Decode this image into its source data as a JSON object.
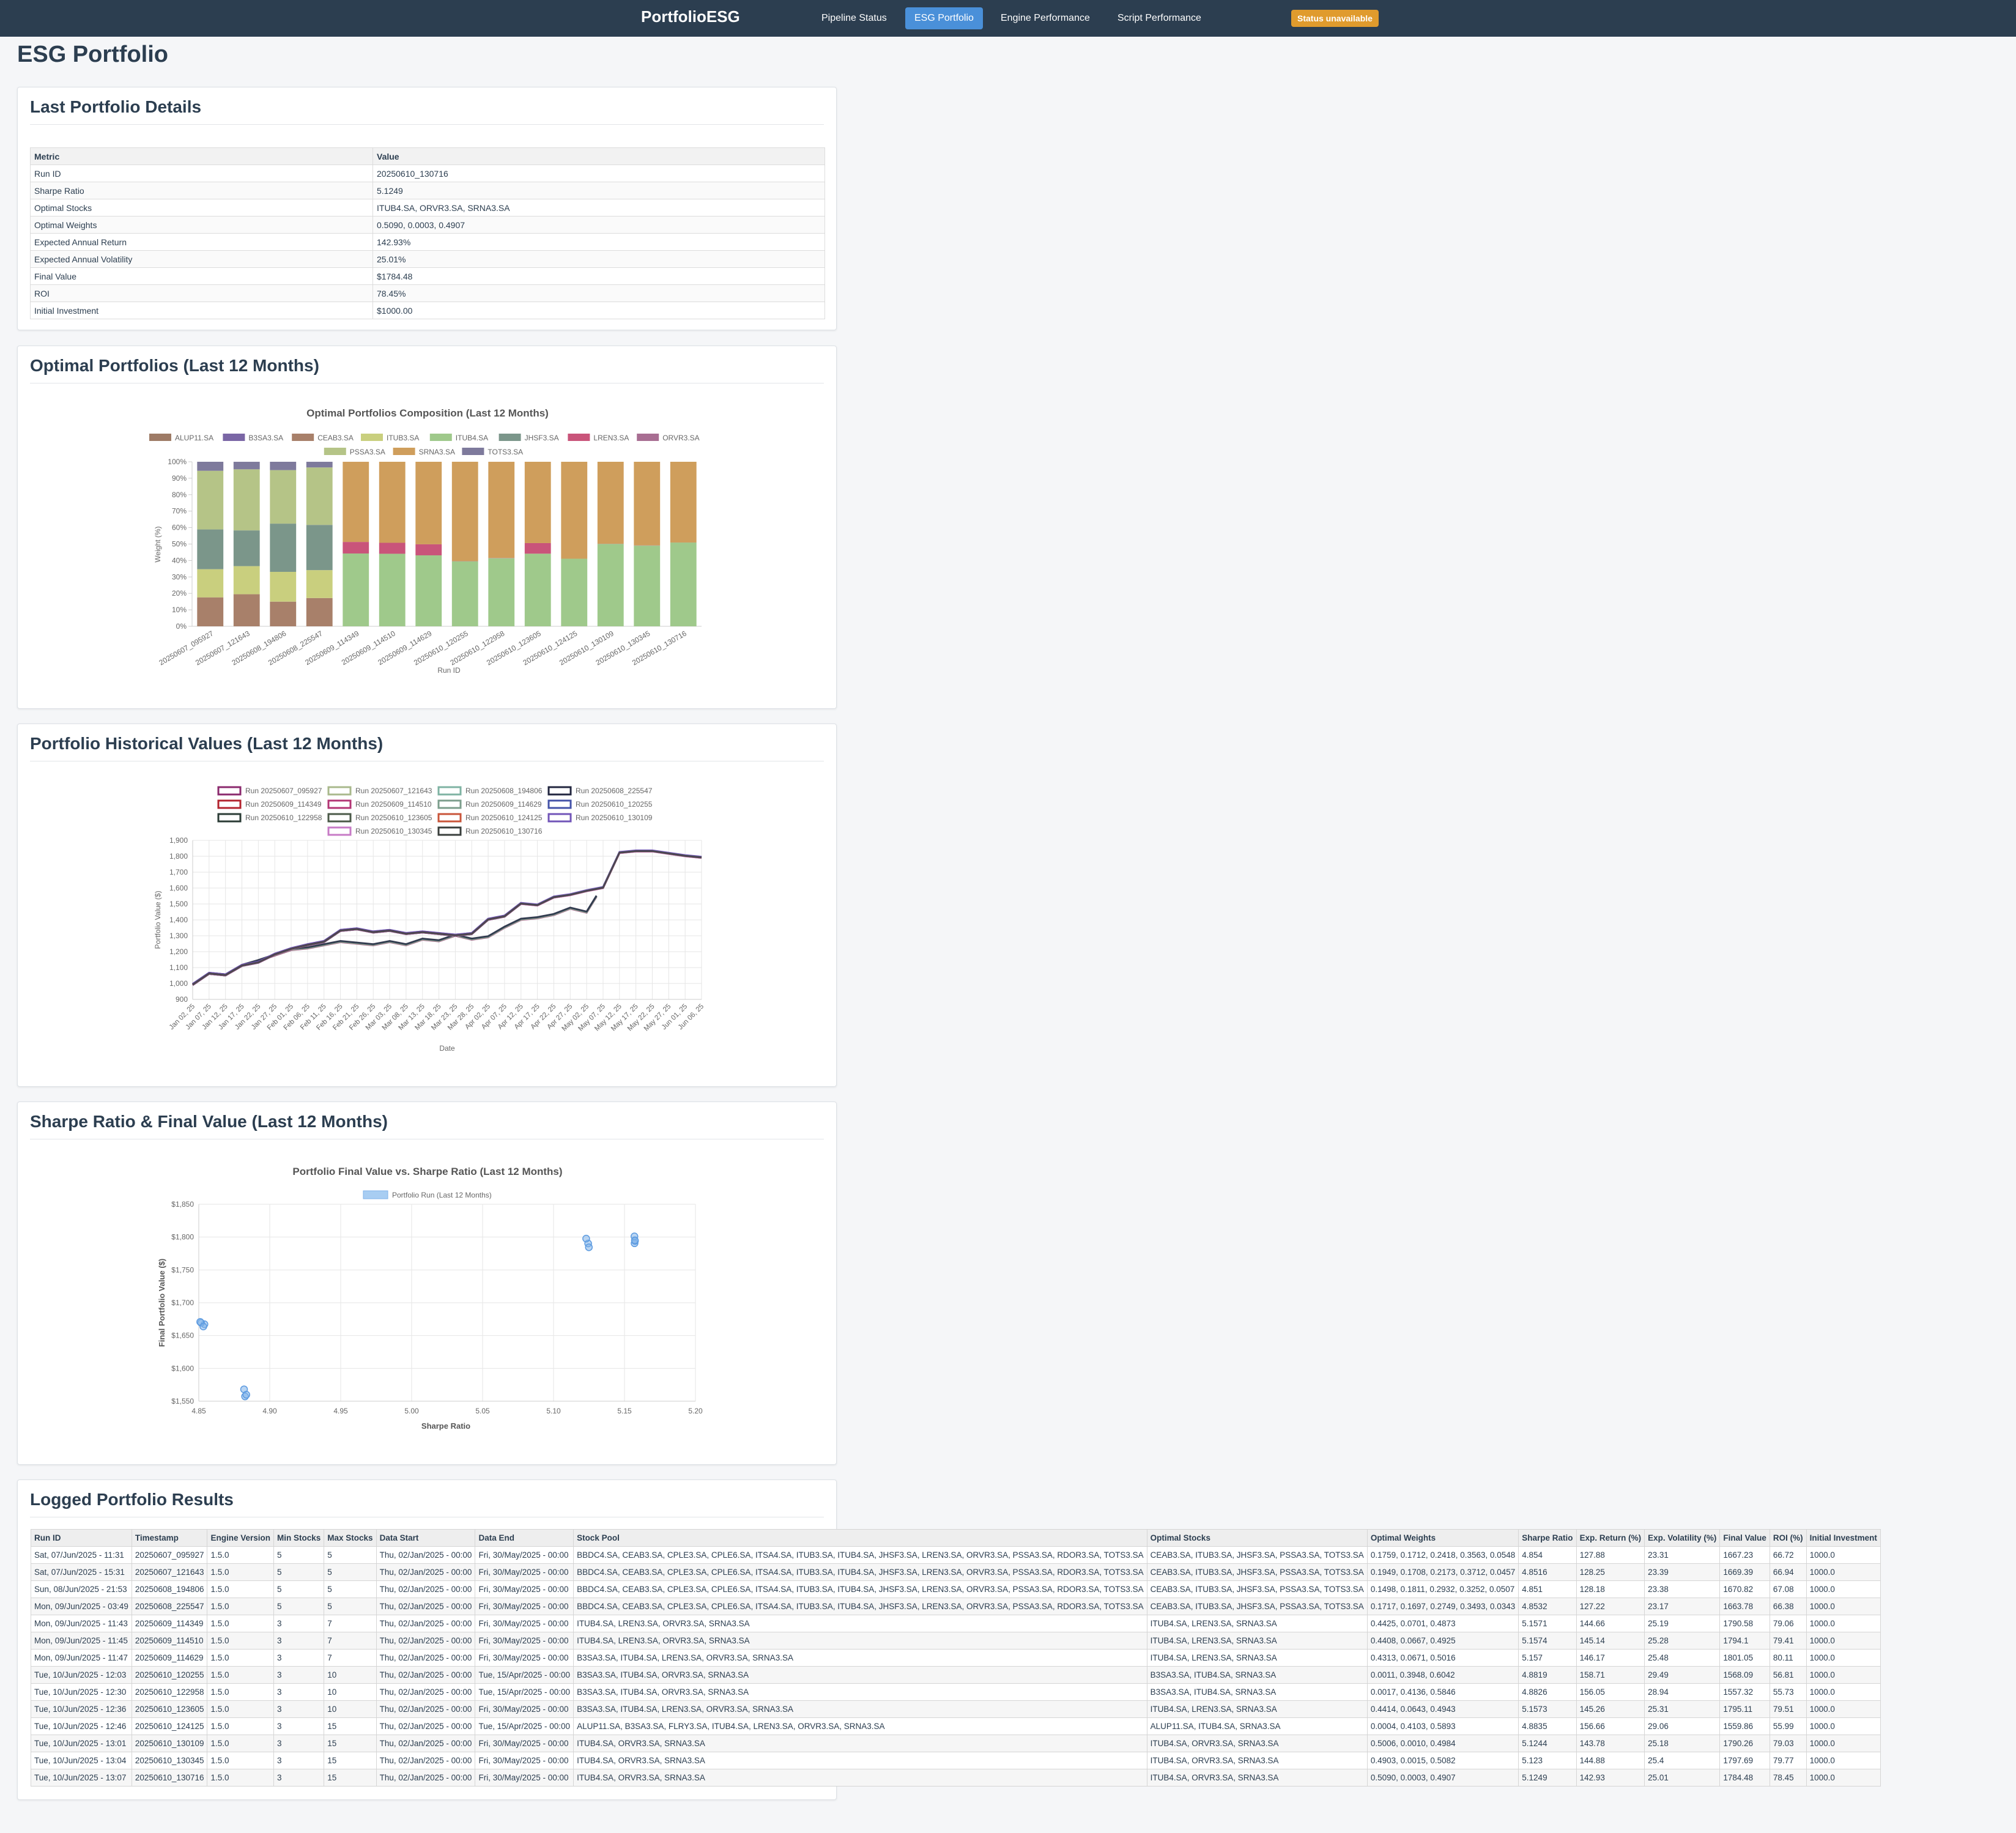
{
  "navbar": {
    "brand": "PortfolioESG",
    "links": [
      "Pipeline Status",
      "ESG Portfolio",
      "Engine Performance",
      "Script Performance"
    ],
    "status": "Status unavailable"
  },
  "page_title": "ESG Portfolio",
  "details": {
    "title": "Last Portfolio Details",
    "headers": [
      "Metric",
      "Value"
    ],
    "rows": [
      [
        "Run ID",
        "20250610_130716"
      ],
      [
        "Sharpe Ratio",
        "5.1249"
      ],
      [
        "Optimal Stocks",
        "ITUB4.SA, ORVR3.SA, SRNA3.SA"
      ],
      [
        "Optimal Weights",
        "0.5090, 0.0003, 0.4907"
      ],
      [
        "Expected Annual Return",
        "142.93%"
      ],
      [
        "Expected Annual Volatility",
        "25.01%"
      ],
      [
        "Final Value",
        "$1784.48"
      ],
      [
        "ROI",
        "78.45%"
      ],
      [
        "Initial Investment",
        "$1000.00"
      ]
    ]
  },
  "composition_section": {
    "title": "Optimal Portfolios (Last 12 Months)"
  },
  "history_section": {
    "title": "Portfolio Historical Values (Last 12 Months)"
  },
  "sharpe_section": {
    "title": "Sharpe Ratio & Final Value (Last 12 Months)"
  },
  "logged_section": {
    "title": "Logged Portfolio Results"
  },
  "chart_data": [
    {
      "type": "bar",
      "stacked": true,
      "title": "Optimal Portfolios Composition (Last 12 Months)",
      "xlabel": "Run ID",
      "ylabel": "Weight (%)",
      "ylim": [
        0,
        100
      ],
      "y_ticks": [
        "0%",
        "10%",
        "20%",
        "30%",
        "40%",
        "50%",
        "60%",
        "70%",
        "80%",
        "90%",
        "100%"
      ],
      "categories": [
        "20250607_095927",
        "20250607_121643",
        "20250608_194806",
        "20250608_225547",
        "20250609_114349",
        "20250609_114510",
        "20250609_114629",
        "20250610_120255",
        "20250610_122958",
        "20250610_123605",
        "20250610_124125",
        "20250610_130109",
        "20250610_130345",
        "20250610_130716"
      ],
      "legend_position": "top",
      "series": [
        {
          "name": "ALUP11.SA",
          "color": "#9e7b66",
          "values": [
            0,
            0,
            0,
            0,
            0,
            0,
            0,
            0,
            0,
            0,
            0.04,
            0,
            0,
            0
          ]
        },
        {
          "name": "B3SA3.SA",
          "color": "#7a66a5",
          "values": [
            0,
            0,
            0,
            0,
            0,
            0,
            0,
            0,
            0,
            0,
            0,
            0,
            0,
            0
          ]
        },
        {
          "name": "CEAB3.SA",
          "color": "#a8806a",
          "values": [
            17.59,
            19.49,
            14.98,
            17.17,
            0,
            0,
            0,
            0,
            0,
            0,
            0,
            0,
            0,
            0
          ]
        },
        {
          "name": "ITUB3.SA",
          "color": "#c9cf7e",
          "values": [
            17.12,
            17.08,
            18.11,
            16.97,
            0,
            0,
            0,
            0,
            0,
            0,
            0,
            0,
            0,
            0
          ]
        },
        {
          "name": "ITUB4.SA",
          "color": "#9fc98b",
          "values": [
            0,
            0,
            0,
            0,
            44.25,
            44.08,
            43.13,
            39.48,
            41.36,
            44.14,
            41.03,
            50.06,
            49.03,
            50.9
          ]
        },
        {
          "name": "JHSF3.SA",
          "color": "#7b968a",
          "values": [
            24.18,
            21.73,
            29.32,
            27.49,
            0,
            0,
            0,
            0,
            0,
            0,
            0,
            0,
            0,
            0
          ]
        },
        {
          "name": "LREN3.SA",
          "color": "#c9547a",
          "values": [
            0,
            0,
            0,
            0,
            7.01,
            6.67,
            6.71,
            0,
            0,
            6.43,
            0,
            0,
            0,
            0
          ]
        },
        {
          "name": "ORVR3.SA",
          "color": "#a86e92",
          "values": [
            0,
            0,
            0,
            0,
            0,
            0,
            0,
            0.11,
            0.17,
            0,
            0,
            0.1,
            0.15,
            0.03
          ]
        },
        {
          "name": "PSSA3.SA",
          "color": "#b5c487",
          "values": [
            35.63,
            37.12,
            32.52,
            34.93,
            0,
            0,
            0,
            0,
            0,
            0,
            0,
            0,
            0,
            0
          ]
        },
        {
          "name": "SRNA3.SA",
          "color": "#cf9e5c",
          "values": [
            0,
            0,
            0,
            0,
            48.73,
            49.25,
            50.16,
            60.42,
            58.46,
            49.43,
            58.93,
            49.84,
            50.82,
            49.07
          ]
        },
        {
          "name": "TOTS3.SA",
          "color": "#7e7a9c",
          "values": [
            5.48,
            4.57,
            5.07,
            3.43,
            0,
            0,
            0,
            0,
            0,
            0,
            0,
            0,
            0,
            0
          ]
        }
      ]
    },
    {
      "type": "line",
      "xlabel": "Date",
      "ylabel": "Portfolio Value ($)",
      "ylim": [
        900,
        1900
      ],
      "y_ticks": [
        "900",
        "1,000",
        "1,100",
        "1,200",
        "1,300",
        "1,400",
        "1,500",
        "1,600",
        "1,700",
        "1,800",
        "1,900"
      ],
      "x_ticks": [
        "Jan 02, 25",
        "Jan 07, 25",
        "Jan 12, 25",
        "Jan 17, 25",
        "Jan 22, 25",
        "Jan 27, 25",
        "Feb 01, 25",
        "Feb 06, 25",
        "Feb 11, 25",
        "Feb 16, 25",
        "Feb 21, 25",
        "Feb 26, 25",
        "Mar 03, 25",
        "Mar 08, 25",
        "Mar 13, 25",
        "Mar 18, 25",
        "Mar 23, 25",
        "Mar 28, 25",
        "Apr 02, 25",
        "Apr 07, 25",
        "Apr 12, 25",
        "Apr 17, 25",
        "Apr 22, 25",
        "Apr 27, 25",
        "May 02, 25",
        "May 07, 25",
        "May 12, 25",
        "May 17, 25",
        "May 22, 25",
        "May 27, 25",
        "Jun 01, 25",
        "Jun 06, 25"
      ],
      "legend_position": "top",
      "series": [
        {
          "name": "Run 20250607_095927",
          "color": "#8b2a6e",
          "group": "A",
          "final": 1667
        },
        {
          "name": "Run 20250607_121643",
          "color": "#a9b98c",
          "group": "A",
          "final": 1669
        },
        {
          "name": "Run 20250608_194806",
          "color": "#7fb3a3",
          "group": "A",
          "final": 1671
        },
        {
          "name": "Run 20250608_225547",
          "color": "#22263f",
          "group": "A",
          "final": 1664
        },
        {
          "name": "Run 20250609_114349",
          "color": "#b3242f",
          "group": "B",
          "final": 1791
        },
        {
          "name": "Run 20250609_114510",
          "color": "#b33675",
          "group": "B",
          "final": 1794
        },
        {
          "name": "Run 20250609_114629",
          "color": "#7c9e8c",
          "group": "B",
          "final": 1801
        },
        {
          "name": "Run 20250610_120255",
          "color": "#4453a8",
          "group": "C",
          "final": 1568
        },
        {
          "name": "Run 20250610_122958",
          "color": "#2b3c36",
          "group": "C",
          "final": 1557
        },
        {
          "name": "Run 20250610_123605",
          "color": "#4b5a48",
          "group": "B",
          "final": 1795
        },
        {
          "name": "Run 20250610_124125",
          "color": "#c9553a",
          "group": "D",
          "final": 1560
        },
        {
          "name": "Run 20250610_130109",
          "color": "#7255b8",
          "group": "B",
          "final": 1790
        },
        {
          "name": "Run 20250610_130345",
          "color": "#c77bc6",
          "group": "B",
          "final": 1798
        },
        {
          "name": "Run 20250610_130716",
          "color": "#3a3f3c",
          "group": "B",
          "final": 1784
        }
      ],
      "group_paths": {
        "A": {
          "x": [
            0,
            5,
            10,
            15,
            20,
            25,
            30,
            35,
            40,
            45,
            50,
            55,
            60,
            65,
            70,
            75,
            80,
            85,
            90,
            95,
            100,
            105,
            110,
            115,
            120,
            123
          ],
          "y": [
            990,
            1060,
            1050,
            1110,
            1140,
            1175,
            1210,
            1220,
            1240,
            1260,
            1250,
            1240,
            1260,
            1240,
            1275,
            1265,
            1300,
            1275,
            1290,
            1350,
            1400,
            1410,
            1430,
            1470,
            1445,
            1545
          ]
        },
        "B": {
          "x": [
            0,
            5,
            10,
            15,
            20,
            25,
            30,
            35,
            40,
            45,
            50,
            55,
            60,
            65,
            70,
            75,
            80,
            85,
            90,
            95,
            100,
            105,
            110,
            115,
            120,
            125,
            130,
            135,
            140,
            145,
            150,
            155
          ],
          "y": [
            990,
            1060,
            1050,
            1110,
            1130,
            1180,
            1215,
            1240,
            1260,
            1330,
            1340,
            1320,
            1330,
            1310,
            1320,
            1310,
            1300,
            1310,
            1400,
            1420,
            1500,
            1490,
            1540,
            1555,
            1580,
            1600,
            1820,
            1830,
            1830,
            1815,
            1800,
            1790
          ]
        }
      }
    },
    {
      "type": "scatter",
      "title": "Portfolio Final Value vs. Sharpe Ratio (Last 12 Months)",
      "xlabel": "Sharpe Ratio",
      "ylabel": "Final Portfolio Value ($)",
      "xlim": [
        4.85,
        5.2
      ],
      "ylim": [
        1550,
        1850
      ],
      "x_ticks": [
        "4.85",
        "4.90",
        "4.95",
        "5.00",
        "5.05",
        "5.10",
        "5.15",
        "5.20"
      ],
      "y_ticks": [
        "$1,550",
        "$1,600",
        "$1,650",
        "$1,700",
        "$1,750",
        "$1,800",
        "$1,850"
      ],
      "legend_position": "top",
      "series": [
        {
          "name": "Portfolio Run (Last 12 Months)",
          "color": "#7fb2ea",
          "points": [
            [
              4.854,
              1667.23
            ],
            [
              4.8516,
              1669.39
            ],
            [
              4.851,
              1670.82
            ],
            [
              4.8532,
              1663.78
            ],
            [
              5.1571,
              1790.58
            ],
            [
              5.1574,
              1794.1
            ],
            [
              5.157,
              1801.05
            ],
            [
              4.8819,
              1568.09
            ],
            [
              4.8826,
              1557.32
            ],
            [
              5.1573,
              1795.11
            ],
            [
              4.8835,
              1559.86
            ],
            [
              5.1244,
              1790.26
            ],
            [
              5.123,
              1797.69
            ],
            [
              5.1249,
              1784.48
            ]
          ]
        }
      ]
    }
  ],
  "logged": {
    "headers": [
      "Run ID",
      "Timestamp",
      "Engine Version",
      "Min Stocks",
      "Max Stocks",
      "Data Start",
      "Data End",
      "Stock Pool",
      "Optimal Stocks",
      "Optimal Weights",
      "Sharpe Ratio",
      "Exp. Return (%)",
      "Exp. Volatility (%)",
      "Final Value",
      "ROI (%)",
      "Initial Investment"
    ],
    "rows": [
      [
        "Sat, 07/Jun/2025 - 11:31",
        "20250607_095927",
        "1.5.0",
        "5",
        "5",
        "Thu, 02/Jan/2025 - 00:00",
        "Fri, 30/May/2025 - 00:00",
        "BBDC4.SA, CEAB3.SA, CPLE3.SA, CPLE6.SA, ITSA4.SA, ITUB3.SA, ITUB4.SA, JHSF3.SA, LREN3.SA, ORVR3.SA, PSSA3.SA, RDOR3.SA, TOTS3.SA",
        "CEAB3.SA, ITUB3.SA, JHSF3.SA, PSSA3.SA, TOTS3.SA",
        "0.1759, 0.1712, 0.2418, 0.3563, 0.0548",
        "4.854",
        "127.88",
        "23.31",
        "1667.23",
        "66.72",
        "1000.0"
      ],
      [
        "Sat, 07/Jun/2025 - 15:31",
        "20250607_121643",
        "1.5.0",
        "5",
        "5",
        "Thu, 02/Jan/2025 - 00:00",
        "Fri, 30/May/2025 - 00:00",
        "BBDC4.SA, CEAB3.SA, CPLE3.SA, CPLE6.SA, ITSA4.SA, ITUB3.SA, ITUB4.SA, JHSF3.SA, LREN3.SA, ORVR3.SA, PSSA3.SA, RDOR3.SA, TOTS3.SA",
        "CEAB3.SA, ITUB3.SA, JHSF3.SA, PSSA3.SA, TOTS3.SA",
        "0.1949, 0.1708, 0.2173, 0.3712, 0.0457",
        "4.8516",
        "128.25",
        "23.39",
        "1669.39",
        "66.94",
        "1000.0"
      ],
      [
        "Sun, 08/Jun/2025 - 21:53",
        "20250608_194806",
        "1.5.0",
        "5",
        "5",
        "Thu, 02/Jan/2025 - 00:00",
        "Fri, 30/May/2025 - 00:00",
        "BBDC4.SA, CEAB3.SA, CPLE3.SA, CPLE6.SA, ITSA4.SA, ITUB3.SA, ITUB4.SA, JHSF3.SA, LREN3.SA, ORVR3.SA, PSSA3.SA, RDOR3.SA, TOTS3.SA",
        "CEAB3.SA, ITUB3.SA, JHSF3.SA, PSSA3.SA, TOTS3.SA",
        "0.1498, 0.1811, 0.2932, 0.3252, 0.0507",
        "4.851",
        "128.18",
        "23.38",
        "1670.82",
        "67.08",
        "1000.0"
      ],
      [
        "Mon, 09/Jun/2025 - 03:49",
        "20250608_225547",
        "1.5.0",
        "5",
        "5",
        "Thu, 02/Jan/2025 - 00:00",
        "Fri, 30/May/2025 - 00:00",
        "BBDC4.SA, CEAB3.SA, CPLE3.SA, CPLE6.SA, ITSA4.SA, ITUB3.SA, ITUB4.SA, JHSF3.SA, LREN3.SA, ORVR3.SA, PSSA3.SA, RDOR3.SA, TOTS3.SA",
        "CEAB3.SA, ITUB3.SA, JHSF3.SA, PSSA3.SA, TOTS3.SA",
        "0.1717, 0.1697, 0.2749, 0.3493, 0.0343",
        "4.8532",
        "127.22",
        "23.17",
        "1663.78",
        "66.38",
        "1000.0"
      ],
      [
        "Mon, 09/Jun/2025 - 11:43",
        "20250609_114349",
        "1.5.0",
        "3",
        "7",
        "Thu, 02/Jan/2025 - 00:00",
        "Fri, 30/May/2025 - 00:00",
        "ITUB4.SA, LREN3.SA, ORVR3.SA, SRNA3.SA",
        "ITUB4.SA, LREN3.SA, SRNA3.SA",
        "0.4425, 0.0701, 0.4873",
        "5.1571",
        "144.66",
        "25.19",
        "1790.58",
        "79.06",
        "1000.0"
      ],
      [
        "Mon, 09/Jun/2025 - 11:45",
        "20250609_114510",
        "1.5.0",
        "3",
        "7",
        "Thu, 02/Jan/2025 - 00:00",
        "Fri, 30/May/2025 - 00:00",
        "ITUB4.SA, LREN3.SA, ORVR3.SA, SRNA3.SA",
        "ITUB4.SA, LREN3.SA, SRNA3.SA",
        "0.4408, 0.0667, 0.4925",
        "5.1574",
        "145.14",
        "25.28",
        "1794.1",
        "79.41",
        "1000.0"
      ],
      [
        "Mon, 09/Jun/2025 - 11:47",
        "20250609_114629",
        "1.5.0",
        "3",
        "7",
        "Thu, 02/Jan/2025 - 00:00",
        "Fri, 30/May/2025 - 00:00",
        "B3SA3.SA, ITUB4.SA, LREN3.SA, ORVR3.SA, SRNA3.SA",
        "ITUB4.SA, LREN3.SA, SRNA3.SA",
        "0.4313, 0.0671, 0.5016",
        "5.157",
        "146.17",
        "25.48",
        "1801.05",
        "80.11",
        "1000.0"
      ],
      [
        "Tue, 10/Jun/2025 - 12:03",
        "20250610_120255",
        "1.5.0",
        "3",
        "10",
        "Thu, 02/Jan/2025 - 00:00",
        "Tue, 15/Apr/2025 - 00:00",
        "B3SA3.SA, ITUB4.SA, ORVR3.SA, SRNA3.SA",
        "B3SA3.SA, ITUB4.SA, SRNA3.SA",
        "0.0011, 0.3948, 0.6042",
        "4.8819",
        "158.71",
        "29.49",
        "1568.09",
        "56.81",
        "1000.0"
      ],
      [
        "Tue, 10/Jun/2025 - 12:30",
        "20250610_122958",
        "1.5.0",
        "3",
        "10",
        "Thu, 02/Jan/2025 - 00:00",
        "Tue, 15/Apr/2025 - 00:00",
        "B3SA3.SA, ITUB4.SA, ORVR3.SA, SRNA3.SA",
        "B3SA3.SA, ITUB4.SA, SRNA3.SA",
        "0.0017, 0.4136, 0.5846",
        "4.8826",
        "156.05",
        "28.94",
        "1557.32",
        "55.73",
        "1000.0"
      ],
      [
        "Tue, 10/Jun/2025 - 12:36",
        "20250610_123605",
        "1.5.0",
        "3",
        "10",
        "Thu, 02/Jan/2025 - 00:00",
        "Fri, 30/May/2025 - 00:00",
        "B3SA3.SA, ITUB4.SA, LREN3.SA, ORVR3.SA, SRNA3.SA",
        "ITUB4.SA, LREN3.SA, SRNA3.SA",
        "0.4414, 0.0643, 0.4943",
        "5.1573",
        "145.26",
        "25.31",
        "1795.11",
        "79.51",
        "1000.0"
      ],
      [
        "Tue, 10/Jun/2025 - 12:46",
        "20250610_124125",
        "1.5.0",
        "3",
        "15",
        "Thu, 02/Jan/2025 - 00:00",
        "Tue, 15/Apr/2025 - 00:00",
        "ALUP11.SA, B3SA3.SA, FLRY3.SA, ITUB4.SA, LREN3.SA, ORVR3.SA, SRNA3.SA",
        "ALUP11.SA, ITUB4.SA, SRNA3.SA",
        "0.0004, 0.4103, 0.5893",
        "4.8835",
        "156.66",
        "29.06",
        "1559.86",
        "55.99",
        "1000.0"
      ],
      [
        "Tue, 10/Jun/2025 - 13:01",
        "20250610_130109",
        "1.5.0",
        "3",
        "15",
        "Thu, 02/Jan/2025 - 00:00",
        "Fri, 30/May/2025 - 00:00",
        "ITUB4.SA, ORVR3.SA, SRNA3.SA",
        "ITUB4.SA, ORVR3.SA, SRNA3.SA",
        "0.5006, 0.0010, 0.4984",
        "5.1244",
        "143.78",
        "25.18",
        "1790.26",
        "79.03",
        "1000.0"
      ],
      [
        "Tue, 10/Jun/2025 - 13:04",
        "20250610_130345",
        "1.5.0",
        "3",
        "15",
        "Thu, 02/Jan/2025 - 00:00",
        "Fri, 30/May/2025 - 00:00",
        "ITUB4.SA, ORVR3.SA, SRNA3.SA",
        "ITUB4.SA, ORVR3.SA, SRNA3.SA",
        "0.4903, 0.0015, 0.5082",
        "5.123",
        "144.88",
        "25.4",
        "1797.69",
        "79.77",
        "1000.0"
      ],
      [
        "Tue, 10/Jun/2025 - 13:07",
        "20250610_130716",
        "1.5.0",
        "3",
        "15",
        "Thu, 02/Jan/2025 - 00:00",
        "Fri, 30/May/2025 - 00:00",
        "ITUB4.SA, ORVR3.SA, SRNA3.SA",
        "ITUB4.SA, ORVR3.SA, SRNA3.SA",
        "0.5090, 0.0003, 0.4907",
        "5.1249",
        "142.93",
        "25.01",
        "1784.48",
        "78.45",
        "1000.0"
      ]
    ]
  }
}
